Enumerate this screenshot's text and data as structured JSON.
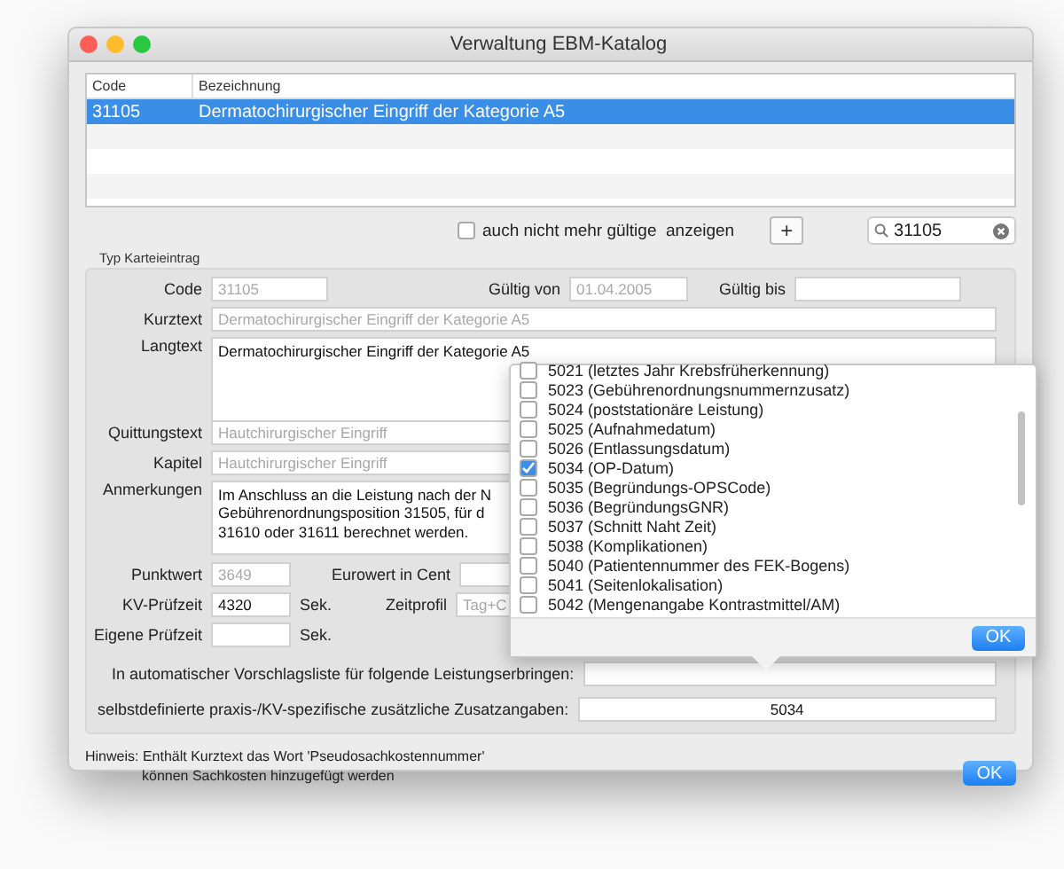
{
  "window": {
    "title": "Verwaltung EBM-Katalog"
  },
  "table": {
    "columns": [
      "Code",
      "Bezeichnung"
    ],
    "rows": [
      {
        "code": "31105",
        "name": "Dermatochirurgischer Eingriff der Kategorie A5",
        "selected": true
      }
    ]
  },
  "filter": {
    "label": "auch nicht mehr gültige  anzeigen",
    "checked": false
  },
  "add_button": "+",
  "search": {
    "value": "31105"
  },
  "group": {
    "title": "Typ Karteieintrag"
  },
  "code": {
    "label": "Code",
    "value": "31105",
    "disabled": true
  },
  "gueltig_von": {
    "label": "Gültig von",
    "value": "01.04.2005",
    "disabled": true
  },
  "gueltig_bis": {
    "label": "Gültig bis"
  },
  "kurztext": {
    "label": "Kurztext",
    "value": "Dermatochirurgischer Eingriff der Kategorie A5",
    "disabled": true
  },
  "langtext": {
    "label": "Langtext",
    "value": "Dermatochirurgischer Eingriff der Kategorie A5"
  },
  "quittungstext": {
    "label": "Quittungstext",
    "value": "Hautchirurgischer Eingriff",
    "disabled": true
  },
  "kapitel": {
    "label": "Kapitel",
    "value": "Hautchirurgischer Eingriff",
    "disabled": true
  },
  "anmerkungen": {
    "label": "Anmerkungen",
    "lines": [
      "Im Anschluss an die Leistung nach der N",
      "Gebührenordnungsposition 31505, für d",
      "31610 oder 31611 berechnet werden."
    ]
  },
  "punktwert": {
    "label": "Punktwert",
    "value": "3649",
    "disabled": true
  },
  "eurowert": {
    "label": "Eurowert in Cent"
  },
  "kv_pruefzeit": {
    "label": "KV-Prüfzeit",
    "value": "4320",
    "unit": "Sek."
  },
  "zeitprofil": {
    "label": "Zeitprofil",
    "value": "Tag+C",
    "disabled": true
  },
  "eigene_pruefzeit": {
    "label": "Eigene Prüfzeit",
    "unit": "Sek."
  },
  "vorschlag": {
    "label": "In automatischer Vorschlagsliste für folgende Leistungserbringen:"
  },
  "zusatz": {
    "label": "selbstdefinierte praxis-/KV-spezifische zusätzliche Zusatzangaben:",
    "value": "5034"
  },
  "popup": {
    "items": [
      {
        "label": "5021 (letztes Jahr Krebsfrüherkennung)",
        "checked": false
      },
      {
        "label": "5023 (Gebührenordnungsnummernzusatz)",
        "checked": false
      },
      {
        "label": "5024 (poststationäre Leistung)",
        "checked": false
      },
      {
        "label": "5025 (Aufnahmedatum)",
        "checked": false
      },
      {
        "label": "5026 (Entlassungsdatum)",
        "checked": false
      },
      {
        "label": "5034 (OP-Datum)",
        "checked": true
      },
      {
        "label": "5035 (Begründungs-OPSCode)",
        "checked": false
      },
      {
        "label": "5036 (BegründungsGNR)",
        "checked": false
      },
      {
        "label": "5037 (Schnitt Naht Zeit)",
        "checked": false
      },
      {
        "label": "5038 (Komplikationen)",
        "checked": false
      },
      {
        "label": "5040 (Patientennummer des FEK-Bogens)",
        "checked": false
      },
      {
        "label": "5041 (Seitenlokalisation)",
        "checked": false
      },
      {
        "label": "5042 (Mengenangabe Kontrastmittel/AM)",
        "checked": false
      }
    ],
    "button": "OK"
  },
  "hint": {
    "lines": [
      "Hinweis: Enthält Kurztext das Wort 'Pseudosachkostennummer'",
      "können Sachkosten hinzugefügt werden"
    ]
  },
  "ok_button": "OK"
}
